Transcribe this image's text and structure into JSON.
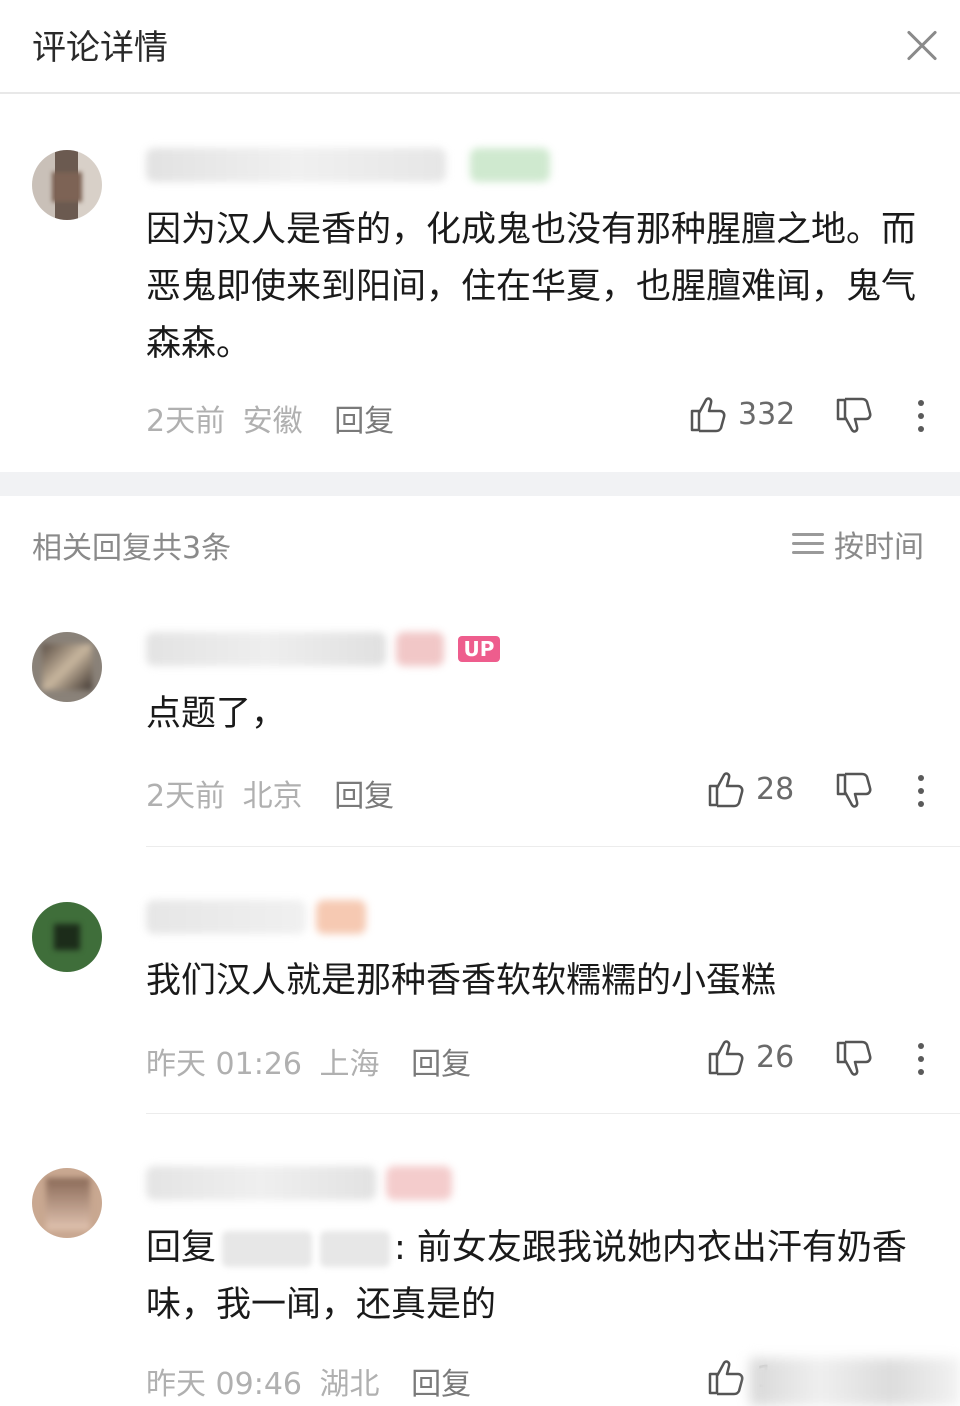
{
  "header": {
    "title": "评论详情"
  },
  "main_comment": {
    "text": "因为汉人是香的，化成鬼也没有那种腥膻之地。而恶鬼即使来到阳间，住在华夏，也腥膻难闻，鬼气森森。",
    "time": "2天前",
    "location": "安徽",
    "reply_label": "回复",
    "likes": "332"
  },
  "replies_header": {
    "title": "相关回复共3条",
    "sort_label": "按时间"
  },
  "replies": [
    {
      "badge": "UP",
      "text": "点题了，",
      "time": "2天前",
      "location": "北京",
      "reply_label": "回复",
      "likes": "28"
    },
    {
      "text": "我们汉人就是那种香香软软糯糯的小蛋糕",
      "time": "昨天 01:26",
      "location": "上海",
      "reply_label": "回复",
      "likes": "26"
    },
    {
      "text_prefix": "回复",
      "text_suffix": ": 前女友跟我说她内衣出汗有奶香味，我一闻，还真是的",
      "time": "昨天 09:46",
      "location": "湖北",
      "reply_label": "回复",
      "likes": "1"
    }
  ],
  "icons": {
    "close": "close-icon",
    "like": "thumb-up-icon",
    "dislike": "thumb-down-icon",
    "more": "more-vertical-icon",
    "sort": "sort-lines-icon"
  },
  "colors": {
    "up_badge": "#ee5d8d",
    "meta_text": "#b0b0b0",
    "divider": "#f1f2f4"
  }
}
